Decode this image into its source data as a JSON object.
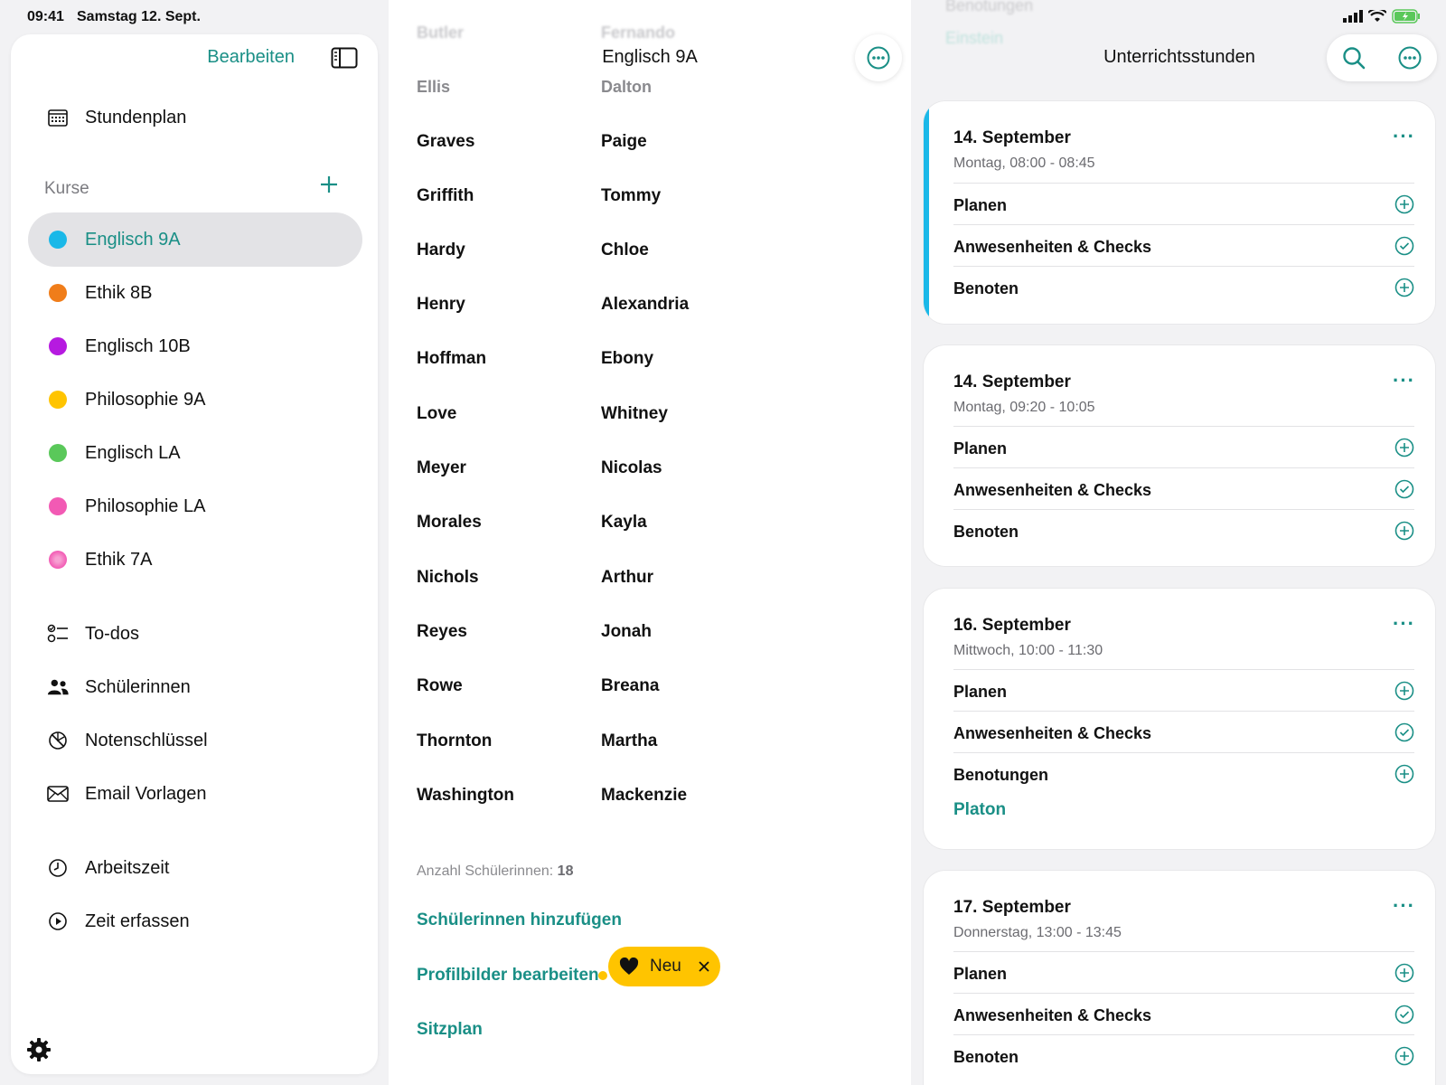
{
  "status": {
    "time": "09:41",
    "date": "Samstag 12. Sept."
  },
  "sidebar": {
    "edit_label": "Bearbeiten",
    "timetable_label": "Stundenplan",
    "courses_header": "Kurse",
    "courses": [
      {
        "label": "Englisch 9A",
        "color": "#1ab8e8"
      },
      {
        "label": "Ethik 8B",
        "color": "#f07d1a"
      },
      {
        "label": "Englisch 10B",
        "color": "#b61ae0"
      },
      {
        "label": "Philosophie 9A",
        "color": "#ffc400"
      },
      {
        "label": "Englisch LA",
        "color": "#5ac85a"
      },
      {
        "label": "Philosophie LA",
        "color": "#f25ab4"
      },
      {
        "label": "Ethik 7A",
        "color": "#f25ab4"
      }
    ],
    "tools": [
      {
        "label": "To-dos",
        "icon": "todo-list-icon"
      },
      {
        "label": "Schülerinnen",
        "icon": "people-icon"
      },
      {
        "label": "Notenschlüssel",
        "icon": "grade-key-icon"
      },
      {
        "label": "Email Vorlagen",
        "icon": "envelope-icon"
      }
    ],
    "time_tools": [
      {
        "label": "Arbeitszeit",
        "icon": "clock-icon"
      },
      {
        "label": "Zeit erfassen",
        "icon": "play-circle-icon"
      }
    ],
    "accent_color": "#1a8f86"
  },
  "middle": {
    "title": "Englisch 9A",
    "ghost_top": {
      "last": "Butler",
      "first": "Fernando"
    },
    "faded": {
      "last": "Ellis",
      "first": "Dalton"
    },
    "students": [
      {
        "last": "Graves",
        "first": "Paige"
      },
      {
        "last": "Griffith",
        "first": "Tommy"
      },
      {
        "last": "Hardy",
        "first": "Chloe"
      },
      {
        "last": "Henry",
        "first": "Alexandria"
      },
      {
        "last": "Hoffman",
        "first": "Ebony"
      },
      {
        "last": "Love",
        "first": "Whitney"
      },
      {
        "last": "Meyer",
        "first": "Nicolas"
      },
      {
        "last": "Morales",
        "first": "Kayla"
      },
      {
        "last": "Nichols",
        "first": "Arthur"
      },
      {
        "last": "Reyes",
        "first": "Jonah"
      },
      {
        "last": "Rowe",
        "first": "Breana"
      },
      {
        "last": "Thornton",
        "first": "Martha"
      },
      {
        "last": "Washington",
        "first": "Mackenzie"
      }
    ],
    "count_label": "Anzahl Schülerinnen:",
    "count_value": "18",
    "links": [
      "Schülerinnen hinzufügen",
      "Profilbilder bearbeiten",
      "Sitzplan"
    ],
    "badge_label": "Neu"
  },
  "right": {
    "title": "Unterrichtsstunden",
    "ghost_top": [
      "Benotungen",
      "Einstein"
    ],
    "lessons": [
      {
        "date": "14. September",
        "time": "Montag, 08:00 - 08:45",
        "rows": [
          {
            "label": "Planen",
            "icon": "plus-circle-icon"
          },
          {
            "label": "Anwesenheiten & Checks",
            "icon": "check-circle-icon"
          },
          {
            "label": "Benoten",
            "icon": "plus-circle-icon"
          }
        ]
      },
      {
        "date": "14. September",
        "time": "Montag, 09:20 - 10:05",
        "rows": [
          {
            "label": "Planen",
            "icon": "plus-circle-icon"
          },
          {
            "label": "Anwesenheiten & Checks",
            "icon": "check-circle-icon"
          },
          {
            "label": "Benoten",
            "icon": "plus-circle-icon"
          }
        ]
      },
      {
        "date": "16. September",
        "time": "Mittwoch, 10:00 - 11:30",
        "rows": [
          {
            "label": "Planen",
            "icon": "plus-circle-icon"
          },
          {
            "label": "Anwesenheiten & Checks",
            "icon": "check-circle-icon"
          },
          {
            "label": "Benotungen",
            "icon": "plus-circle-icon"
          }
        ],
        "link": "Platon"
      },
      {
        "date": "17. September",
        "time": "Donnerstag, 13:00 - 13:45",
        "rows": [
          {
            "label": "Planen",
            "icon": "plus-circle-icon"
          },
          {
            "label": "Anwesenheiten & Checks",
            "icon": "check-circle-icon"
          },
          {
            "label": "Benoten",
            "icon": "plus-circle-icon"
          }
        ]
      }
    ]
  }
}
